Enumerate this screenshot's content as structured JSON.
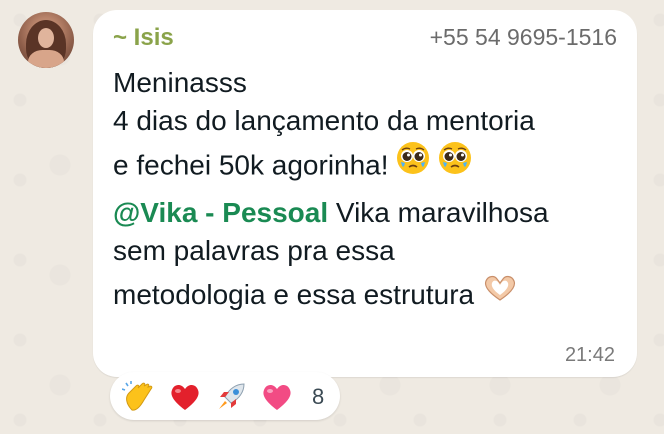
{
  "sender": {
    "name": "~ Isis",
    "phone": "+55 54 9695-1516"
  },
  "message": {
    "line1": "Meninasss",
    "line2": "4 dias do lançamento da mentoria",
    "line3": "e fechei 50k agorinha!",
    "mention": "@Vika - Pessoal",
    "line4_rest": " Vika maravilhosa",
    "line5": "sem palavras pra essa",
    "line6": "metodologia e essa estrutura"
  },
  "timestamp": "21:42",
  "reactions": {
    "items": [
      "clap-emoji",
      "red-heart-emoji",
      "rocket-emoji",
      "pink-heart-emoji"
    ],
    "count": "8"
  },
  "colors": {
    "sender_name": "#8aa34a",
    "mention": "#1a8a53",
    "bubble": "#ffffff",
    "wallpaper": "#efeae2"
  }
}
